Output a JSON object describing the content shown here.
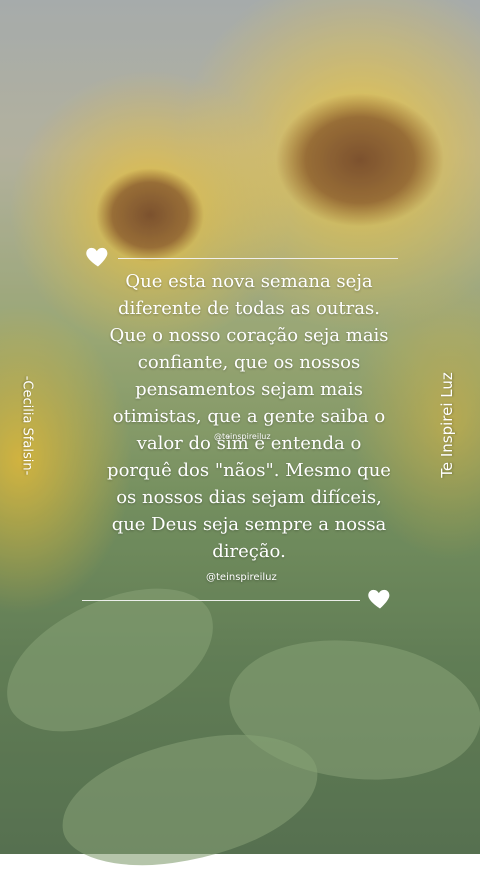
{
  "quote": {
    "lines": [
      "Que esta nova semana seja",
      "diferente de todas as outras.",
      "Que o nosso coração seja mais",
      "confiante, que os nossos",
      "pensamentos sejam mais",
      "otimistas, que a gente saiba o",
      "valor do sim e entenda o",
      "porquê dos \"nãos\". Mesmo que",
      "os nossos dias sejam difíceis,",
      "que Deus seja sempre a nossa",
      "direção."
    ]
  },
  "watermark": {
    "center_handle": "@teinspireiluz",
    "bottom_handle": "@teinspireiluz"
  },
  "side_text": {
    "left": "-Cecilia Sfalsin-",
    "right": "Te Inspirei Luz"
  },
  "icons": {
    "top_heart": "heart-icon",
    "bottom_heart": "heart-icon"
  }
}
